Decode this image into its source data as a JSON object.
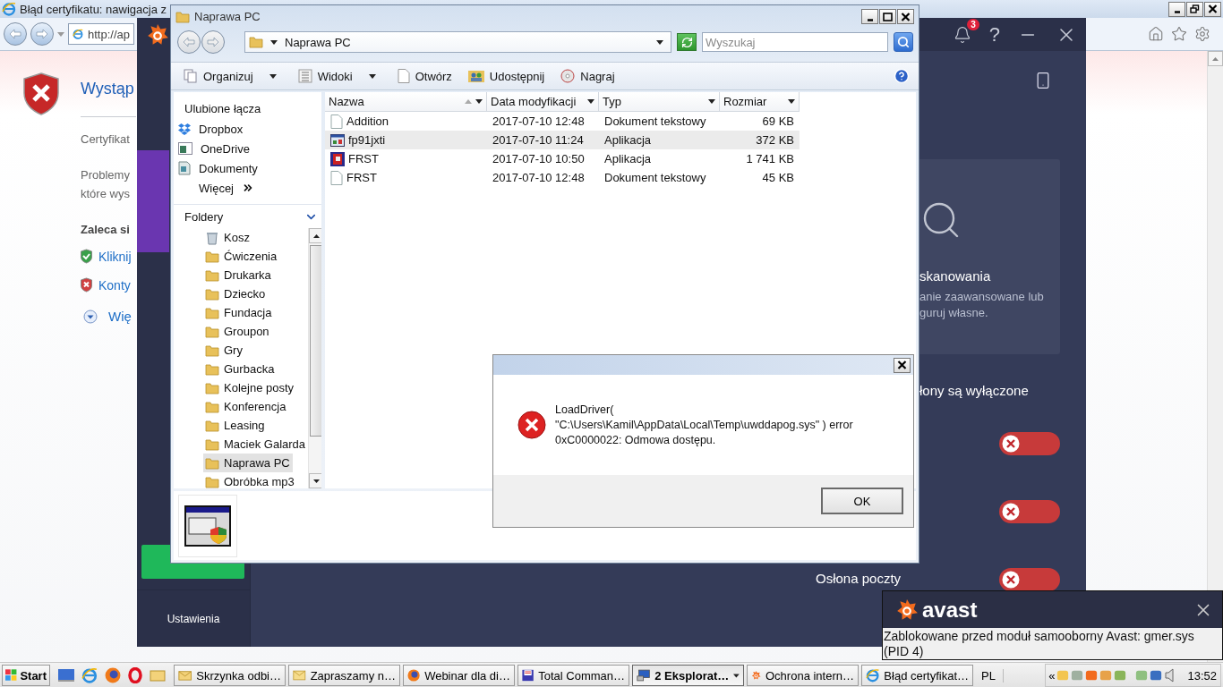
{
  "browser": {
    "title": "Błąd certyfikatu: nawigacja z",
    "address": "http://ap",
    "heading": "Wystąp",
    "intro": "Certyfikat",
    "problem": "Problemy\nktóre wys",
    "recommend": "Zaleca si",
    "options": [
      {
        "kind": "safe",
        "label": "Kliknij"
      },
      {
        "kind": "unsafe",
        "label": "Konty"
      }
    ],
    "more": "Wię"
  },
  "avast": {
    "badge": "3",
    "help": "?",
    "settings": "Ustawienia",
    "card": {
      "title": "skanowania",
      "text": "anie zaawansowane lub\nguruj własne."
    },
    "status": "łony są wyłączone",
    "shields": [
      {
        "on": false
      },
      {
        "on": false
      },
      {
        "label": "Osłona poczty",
        "on": false
      }
    ]
  },
  "explorer": {
    "title": "Naprawa PC",
    "path": "Naprawa PC",
    "search_placeholder": "Wyszukaj",
    "toolbar": [
      {
        "label": "Organizuj",
        "kind": "organize",
        "dropdown": true
      },
      {
        "label": "Widoki",
        "kind": "views",
        "dropdown": true
      },
      {
        "label": "Otwórz",
        "kind": "open"
      },
      {
        "label": "Udostępnij",
        "kind": "share"
      },
      {
        "label": "Nagraj",
        "kind": "burn"
      }
    ],
    "favorites_title": "Ulubione łącza",
    "favorites": [
      {
        "kind": "dropbox",
        "label": "Dropbox"
      },
      {
        "kind": "onedrive",
        "label": "OneDrive"
      },
      {
        "kind": "documents",
        "label": "Dokumenty"
      }
    ],
    "more": "Więcej",
    "folders_title": "Foldery",
    "folders": [
      {
        "label": "Kosz",
        "kind": "bin",
        "selected": false
      },
      {
        "label": "Ćwiczenia",
        "kind": "folder",
        "selected": false
      },
      {
        "label": "Drukarka",
        "kind": "folder",
        "selected": false
      },
      {
        "label": "Dziecko",
        "kind": "folder",
        "selected": false
      },
      {
        "label": "Fundacja",
        "kind": "folder",
        "selected": false
      },
      {
        "label": "Groupon",
        "kind": "folder",
        "selected": false
      },
      {
        "label": "Gry",
        "kind": "folder",
        "selected": false
      },
      {
        "label": "Gurbacka",
        "kind": "folder",
        "selected": false
      },
      {
        "label": "Kolejne posty",
        "kind": "folder",
        "selected": false
      },
      {
        "label": "Konferencja",
        "kind": "folder",
        "selected": false
      },
      {
        "label": "Leasing",
        "kind": "folder",
        "selected": false
      },
      {
        "label": "Maciek Galarda",
        "kind": "folder",
        "selected": false
      },
      {
        "label": "Naprawa PC",
        "kind": "folder",
        "selected": true
      },
      {
        "label": "Obróbka mp3",
        "kind": "folder",
        "selected": false
      }
    ],
    "columns": [
      "Nazwa",
      "Data modyfikacji",
      "Typ",
      "Rozmiar"
    ],
    "files": [
      {
        "name": "Addition",
        "kind": "text",
        "date": "2017-07-10 12:48",
        "type": "Dokument tekstowy",
        "size": "69 KB",
        "selected": false
      },
      {
        "name": "fp91jxti",
        "kind": "app",
        "date": "2017-07-10 11:24",
        "type": "Aplikacja",
        "size": "372 KB",
        "selected": true
      },
      {
        "name": "FRST",
        "kind": "frst",
        "date": "2017-07-10 10:50",
        "type": "Aplikacja",
        "size": "1 741 KB",
        "selected": false
      },
      {
        "name": "FRST",
        "kind": "text",
        "date": "2017-07-10 12:48",
        "type": "Dokument tekstowy",
        "size": "45 KB",
        "selected": false
      }
    ]
  },
  "dialog": {
    "message": "LoadDriver(\n\"C:\\Users\\Kamil\\AppData\\Local\\Temp\\uwddapog.sys\" ) error\n0xC0000022: Odmowa dostępu.",
    "button": "OK"
  },
  "popup": {
    "brand": "avast",
    "message": "Zablokowane przed moduł samooborny Avast: gmer.sys (PID 4)"
  },
  "taskbar": {
    "start": "Start",
    "tasks": [
      {
        "label": "Skrzynka odbi…",
        "kind": "mailbox",
        "active": false
      },
      {
        "label": "Zapraszamy n…",
        "kind": "mail",
        "active": false
      },
      {
        "label": "Webinar dla di…",
        "kind": "firefox",
        "active": false
      },
      {
        "label": "Total Comman…",
        "kind": "floppy",
        "active": false
      },
      {
        "label": "2 Eksplorat…",
        "kind": "explorer",
        "active": true
      },
      {
        "label": "Ochrona intern…",
        "kind": "avast",
        "active": false
      },
      {
        "label": "Błąd certyfikat…",
        "kind": "ie",
        "active": false
      }
    ],
    "language": "PL",
    "tray_toggle": "«",
    "clock": "13:52"
  }
}
